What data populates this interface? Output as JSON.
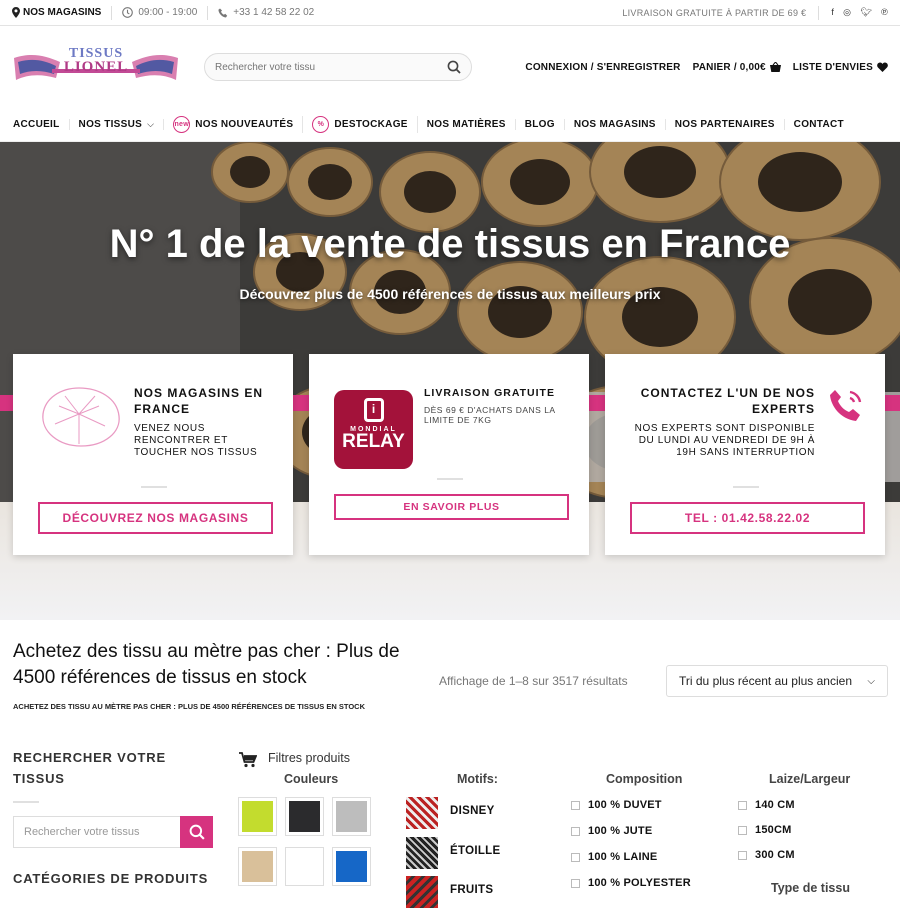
{
  "topbar": {
    "stores": "NOS MAGASINS",
    "hours": "09:00 - 19:00",
    "phone": "+33 1 42 58 22 02",
    "shipping": "LIVRAISON GRATUITE À PARTIR DE 69 €"
  },
  "header": {
    "logo_line1": "TISSUS",
    "logo_line2": "LIONEL",
    "search_placeholder": "Rechercher votre tissu",
    "login": "CONNEXION / S'ENREGISTRER",
    "cart": "PANIER / 0,00€",
    "wishlist": "LISTE D'ENVIES"
  },
  "nav": [
    "ACCUEIL",
    "NOS TISSUS",
    "NOS NOUVEAUTÉS",
    "DESTOCKAGE",
    "NOS MATIÈRES",
    "BLOG",
    "NOS MAGASINS",
    "NOS PARTENAIRES",
    "CONTACT"
  ],
  "hero": {
    "title": "N° 1 de la vente de tissus en France",
    "subtitle": "Découvrez plus de 4500 références de tissus aux meilleurs prix"
  },
  "cards": [
    {
      "title": "NOS MAGASINS EN FRANCE",
      "text": "VENEZ NOUS RENCONTRER ET TOUCHER NOS TISSUS",
      "button": "DÉCOUVREZ NOS MAGASINS"
    },
    {
      "title": "LIVRAISON GRATUITE",
      "text": "DÈS 69 € D'ACHATS DANS LA LIMITE DE 7KG",
      "logo_line1": "MONDIAL",
      "logo_line2": "relay",
      "button": "EN SAVOIR PLUS"
    },
    {
      "title": "CONTACTEZ L'UN DE NOS EXPERTS",
      "text": "NOS EXPERTS SONT DISPONIBLE DU LUNDI AU VENDREDI DE 9H À 19H SANS INTERRUPTION",
      "button": "TEL : 01.42.58.22.02"
    }
  ],
  "shop": {
    "title": "Achetez des tissu au mètre pas cher : Plus de 4500 références de tissus en stock",
    "breadcrumb": "ACHETEZ DES TISSU AU MÈTRE PAS CHER : PLUS DE 4500 RÉFÉRENCES DE TISSUS EN STOCK",
    "results": "Affichage de 1–8 sur 3517 résultats",
    "sort": "Tri du plus récent au plus ancien"
  },
  "sidebar": {
    "search_title": "RECHERCHER VOTRE TISSUS",
    "search_placeholder": "Rechercher votre tissus",
    "categories_title": "CATÉGORIES DE PRODUITS"
  },
  "filters": {
    "title": "Filtres produits",
    "colors_title": "Couleurs",
    "colors": [
      "#c3dc2e",
      "#2b2b2d",
      "#bdbdbd",
      "#d9c09a",
      "#ffffff",
      "#1667c7"
    ],
    "motifs_title": "Motifs:",
    "motifs": [
      "DISNEY",
      "ÉTOILLE",
      "FRUITS"
    ],
    "composition_title": "Composition",
    "composition": [
      "100 % DUVET",
      "100 % JUTE",
      "100 % LAINE",
      "100 % POLYESTER"
    ],
    "width_title": "Laize/Largeur",
    "widths": [
      "140 CM",
      "150CM",
      "300 CM"
    ],
    "type_title": "Type de tissu"
  },
  "colors": {
    "accent": "#d6337f"
  }
}
